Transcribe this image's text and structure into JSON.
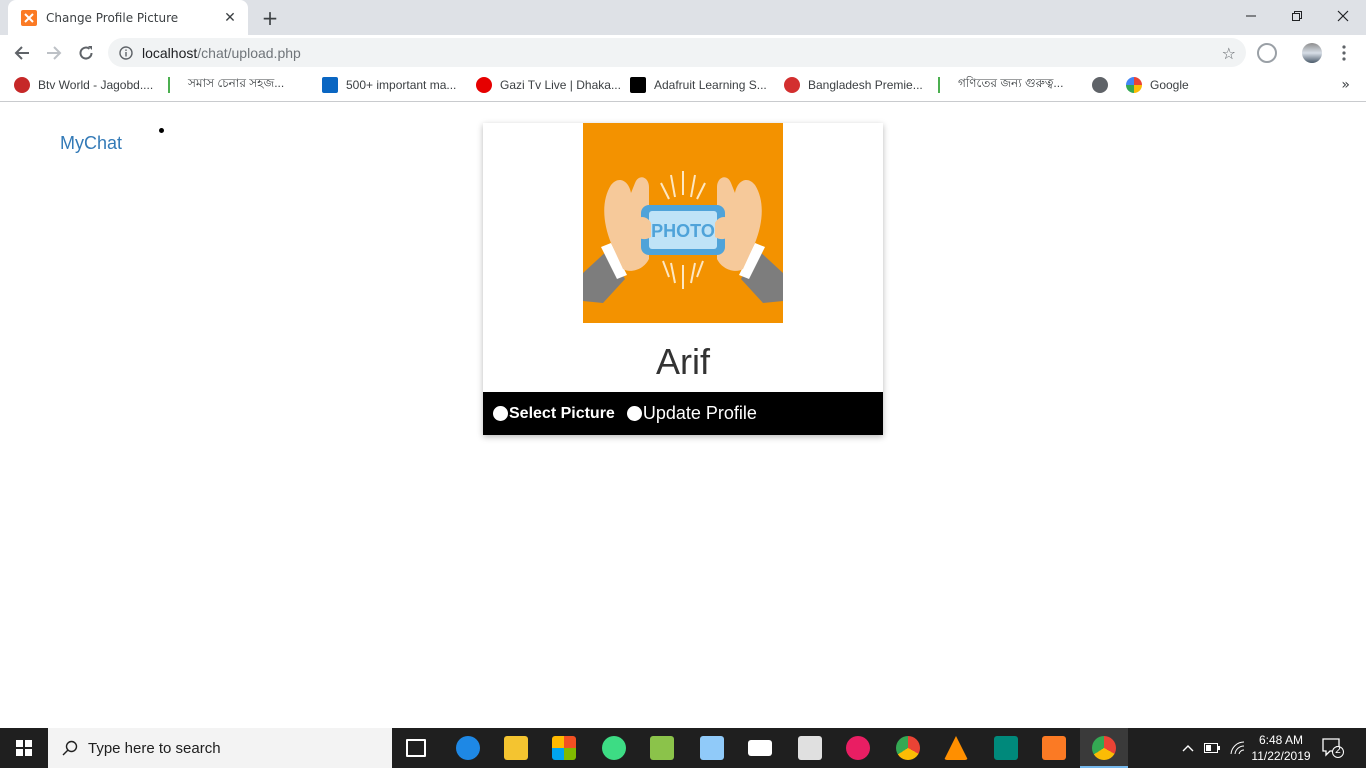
{
  "browser": {
    "tab_title": "Change Profile Picture",
    "url_host": "localhost",
    "url_path": "/chat/upload.php"
  },
  "bookmarks": [
    {
      "label": "Btv World - Jagobd....",
      "icon": "red-ball-icon",
      "color": "#c62828"
    },
    {
      "label": "সমাস চেনার সহজ...",
      "icon": "figure-icon",
      "color": "#4caf50"
    },
    {
      "label": "500+ important ma...",
      "icon": "linkedin-icon",
      "color": "#0a66c2"
    },
    {
      "label": "Gazi Tv Live | Dhaka...",
      "icon": "vodafone-icon",
      "color": "#e60000"
    },
    {
      "label": "Adafruit Learning S...",
      "icon": "star-icon",
      "color": "#000000"
    },
    {
      "label": "Bangladesh Premie...",
      "icon": "cricket-ball-icon",
      "color": "#d32f2f"
    },
    {
      "label": "গণিতের জন্য গুরুত্ব...",
      "icon": "figure-icon",
      "color": "#4caf50"
    },
    {
      "label": "",
      "icon": "globe-icon",
      "color": "#5f6368"
    },
    {
      "label": "Google",
      "icon": "google-icon",
      "color": "#4285f4"
    }
  ],
  "page": {
    "brand": "MyChat",
    "username": "Arif",
    "photo_label": "PHOTO",
    "actions": {
      "select": "Select Picture",
      "update": "Update Profile"
    }
  },
  "taskbar": {
    "search_placeholder": "Type here to search",
    "time": "6:48 AM",
    "date": "11/22/2019",
    "notification_count": "2"
  },
  "colors": {
    "brand_link": "#337ab7",
    "photo_bg": "#f39200",
    "action_bar": "#000000"
  }
}
